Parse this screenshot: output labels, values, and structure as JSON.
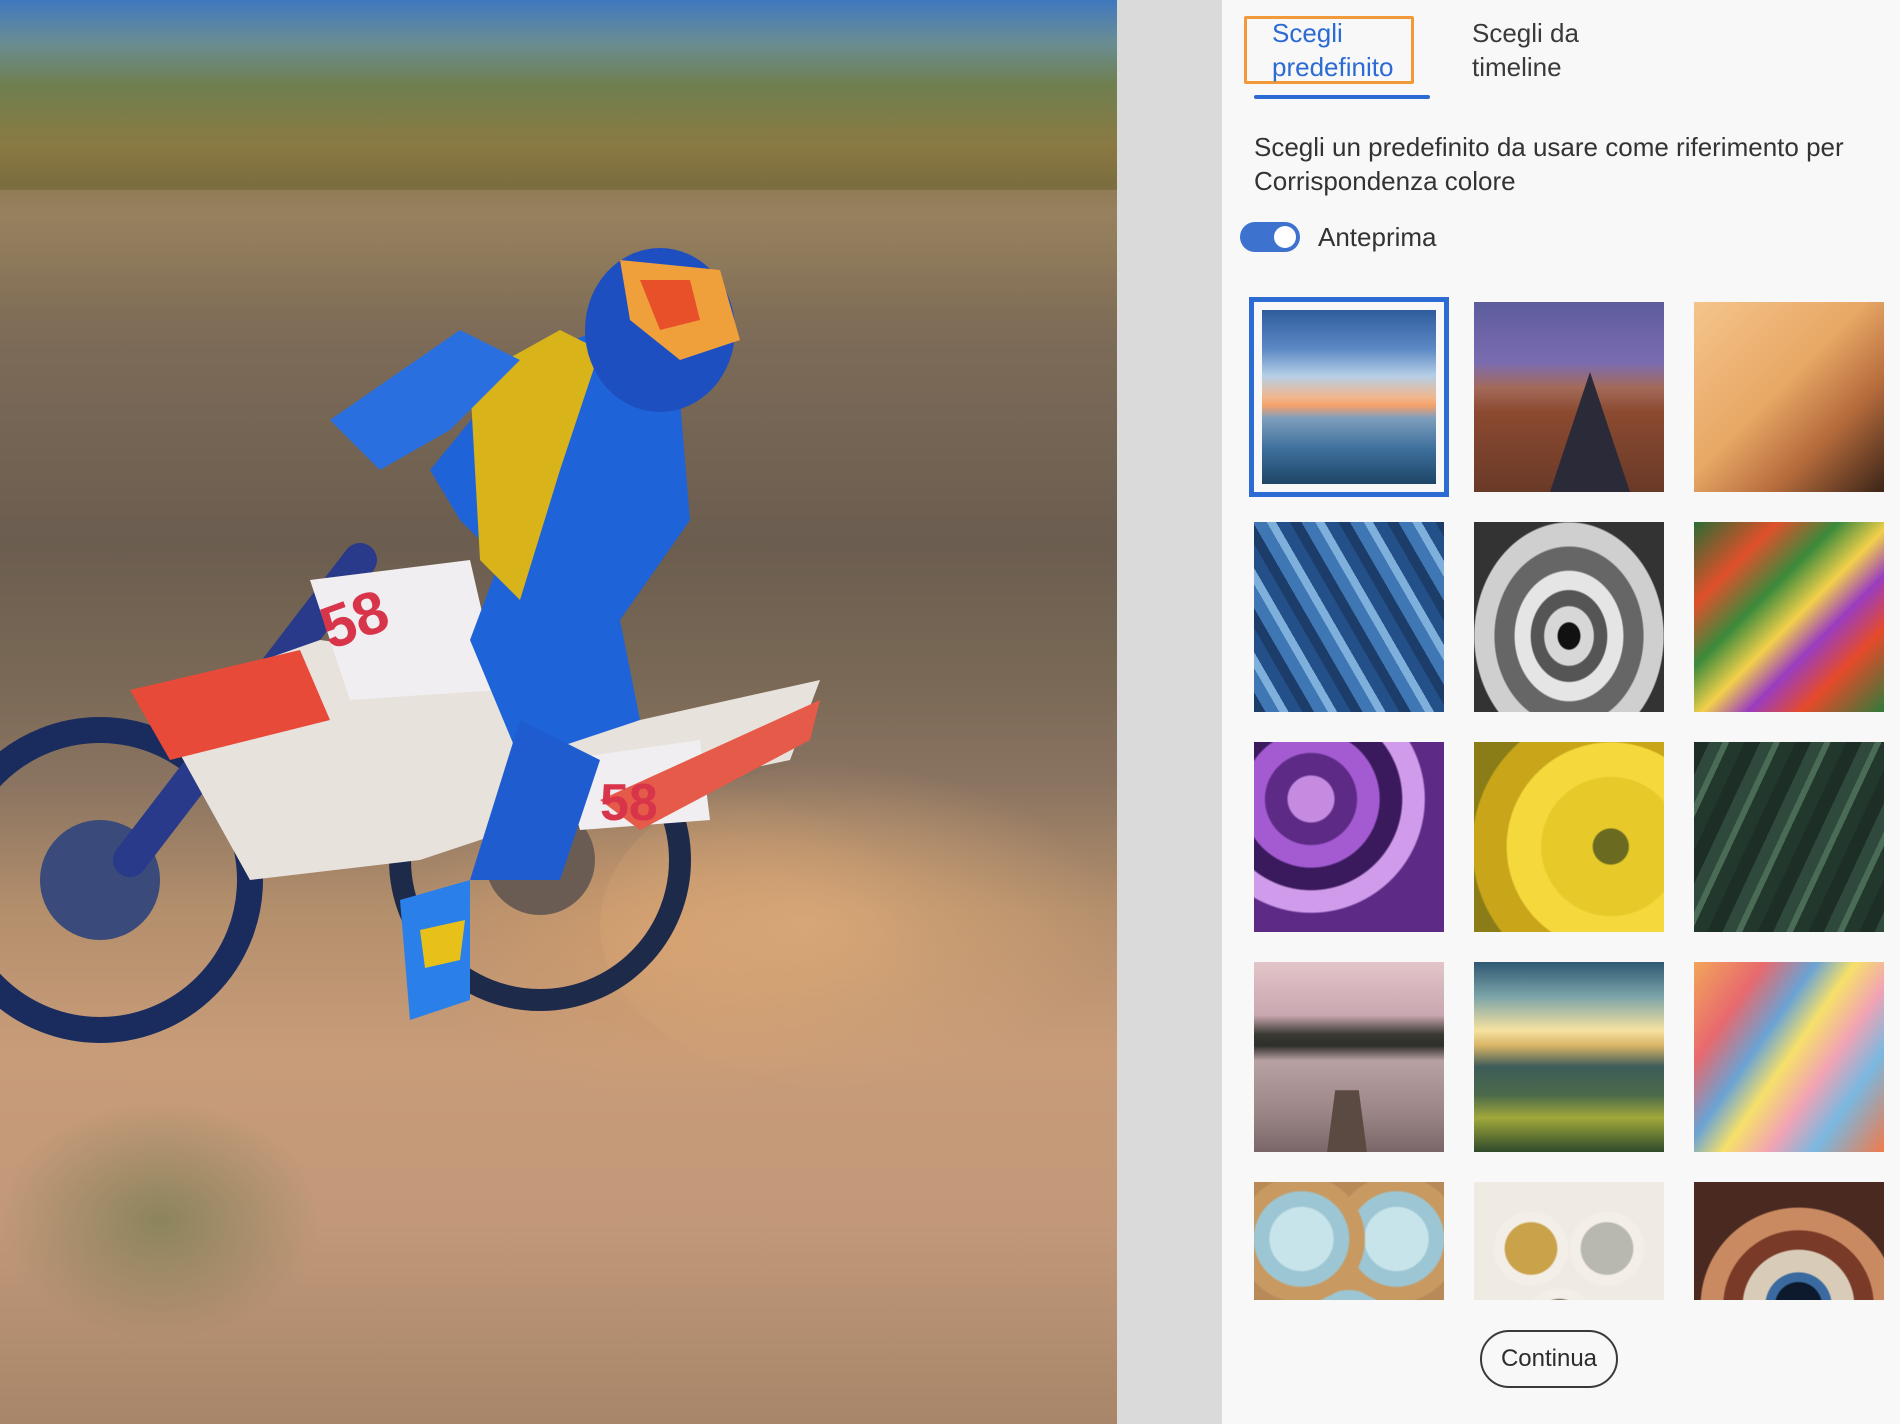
{
  "tabs": {
    "preset_label": "Scegli predefinito",
    "timeline_label": "Scegli da timeline",
    "active": "preset"
  },
  "panel": {
    "description": "Scegli un predefinito da usare come riferimento per Corrispondenza colore",
    "preview_toggle": {
      "label": "Anteprima",
      "on": true
    },
    "continue_label": "Continua"
  },
  "presets": [
    {
      "name": "sky-lake-sunset-thumbnail",
      "selected": true
    },
    {
      "name": "desert-road-thumbnail",
      "selected": false
    },
    {
      "name": "skateboarder-thumbnail",
      "selected": false
    },
    {
      "name": "blue-feathers-thumbnail",
      "selected": false
    },
    {
      "name": "cloister-arches-thumbnail",
      "selected": false
    },
    {
      "name": "abstract-paint-thumbnail",
      "selected": false
    },
    {
      "name": "lilac-flowers-thumbnail",
      "selected": false
    },
    {
      "name": "yellow-flower-thumbnail",
      "selected": false
    },
    {
      "name": "monstera-leaves-thumbnail",
      "selected": false
    },
    {
      "name": "lake-dock-thumbnail",
      "selected": false
    },
    {
      "name": "valley-sunset-thumbnail",
      "selected": false
    },
    {
      "name": "pastel-oil-paint-thumbnail",
      "selected": false
    },
    {
      "name": "cupcakes-thumbnail",
      "selected": false
    },
    {
      "name": "scrunchies-thumbnail",
      "selected": false
    },
    {
      "name": "spaceship-window-thumbnail",
      "selected": false
    }
  ],
  "canvas": {
    "subject": "motocross-rider-photo",
    "bike_number": "58"
  },
  "colors": {
    "accent": "#2c6ad4",
    "focus_outline": "#f29a3a",
    "panel_bg": "#f8f8f8"
  }
}
